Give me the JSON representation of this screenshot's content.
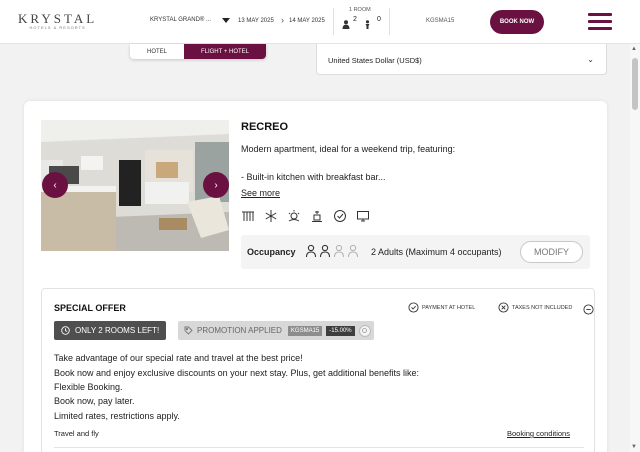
{
  "header": {
    "logo_main": "KRYSTAL",
    "logo_sub": "HOTELS & RESORTS",
    "hotel_name": "KRYSTAL GRAND® ...",
    "check_in": "13 MAY 2025",
    "check_out": "14 MAY 2025",
    "rooms_label": "1 ROOM",
    "adults": "2",
    "children": "0",
    "promo_code": "KGSMA15",
    "book_now_label": "BOOK NOW"
  },
  "booking_type": {
    "options": [
      "HOTEL",
      "FLIGHT + HOTEL"
    ],
    "selected": "FLIGHT + HOTEL"
  },
  "currency": {
    "selected": "United States Dollar (USD$)"
  },
  "room": {
    "name": "RECREO",
    "description_line1": "Modern apartment, ideal for a weekend trip, featuring:",
    "description_line2": "- Built-in kitchen with breakfast bar...",
    "see_more": "See more",
    "amenity_icons": [
      "heater-icon",
      "air-conditioning-icon",
      "weather-icon",
      "coffee-maker-icon",
      "check-badge-icon",
      "tv-icon"
    ],
    "occupancy_label": "Occupancy",
    "occupancy_filled": 2,
    "occupancy_max": 4,
    "occupancy_text": "2 Adults (Maximum 4 occupants)",
    "modify_label": "MODIFY"
  },
  "offer": {
    "title": "SPECIAL OFFER",
    "payment_label": "PAYMENT AT HOTEL",
    "taxes_label": "TAXES NOT INCLUDED",
    "rooms_left": "ONLY 2 ROOMS LEFT!",
    "promo_applied": "PROMOTION APPLIED",
    "promo_code": "KGSMA15",
    "promo_discount": "-15.00%",
    "lines": [
      "Take advantage of our special rate and travel at the best price!",
      "Book now and enjoy exclusive discounts on your next stay. Plus, get additional benefits like:",
      "Flexible Booking.",
      "Book now, pay later.",
      "Limited rates, restrictions apply."
    ],
    "footer_left": "Travel and fly",
    "footer_right": "Booking conditions"
  },
  "colors": {
    "brand": "#6b1142",
    "badge_dark": "#4f4f4f",
    "badge_grey": "#d8d8d8"
  }
}
